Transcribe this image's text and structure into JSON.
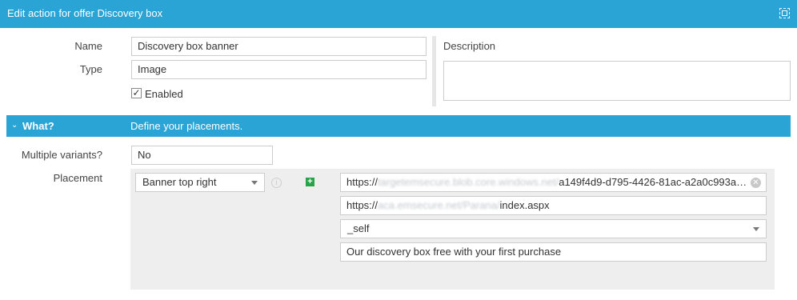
{
  "window": {
    "title": "Edit action for offer Discovery box"
  },
  "form": {
    "name_label": "Name",
    "name_value": "Discovery box banner",
    "type_label": "Type",
    "type_value": "Image",
    "enabled_label": "Enabled",
    "enabled_checked": true,
    "description_label": "Description",
    "description_value": ""
  },
  "section": {
    "title": "What?",
    "subtitle": "Define your placements."
  },
  "placement": {
    "multiple_variants_label": "Multiple variants?",
    "multiple_variants_value": "No",
    "placement_label": "Placement",
    "placement_select": "Banner top right",
    "image_url_prefix": "https://",
    "image_url_obscured": "targetemsecure.blob.core.windows.net/",
    "image_url_suffix": "a149f4d9-d795-4426-81ac-a2a0c993a…",
    "link_url_prefix": "https://",
    "link_url_obscured": "aca.emsecure.net/Parana/",
    "link_url_suffix": "index.aspx",
    "target_value": "_self",
    "alt_text_value": "Our discovery box free with your first purchase"
  },
  "icons": {
    "expand": "fullscreen-icon",
    "chevron": "chevron-down-icon",
    "info": "info-icon",
    "add": "plus-icon",
    "clear": "clear-icon",
    "check": "checkmark-icon"
  },
  "colors": {
    "header_blue": "#2aa4d5",
    "add_green": "#27a34a",
    "panel_gray": "#eeeeee"
  }
}
